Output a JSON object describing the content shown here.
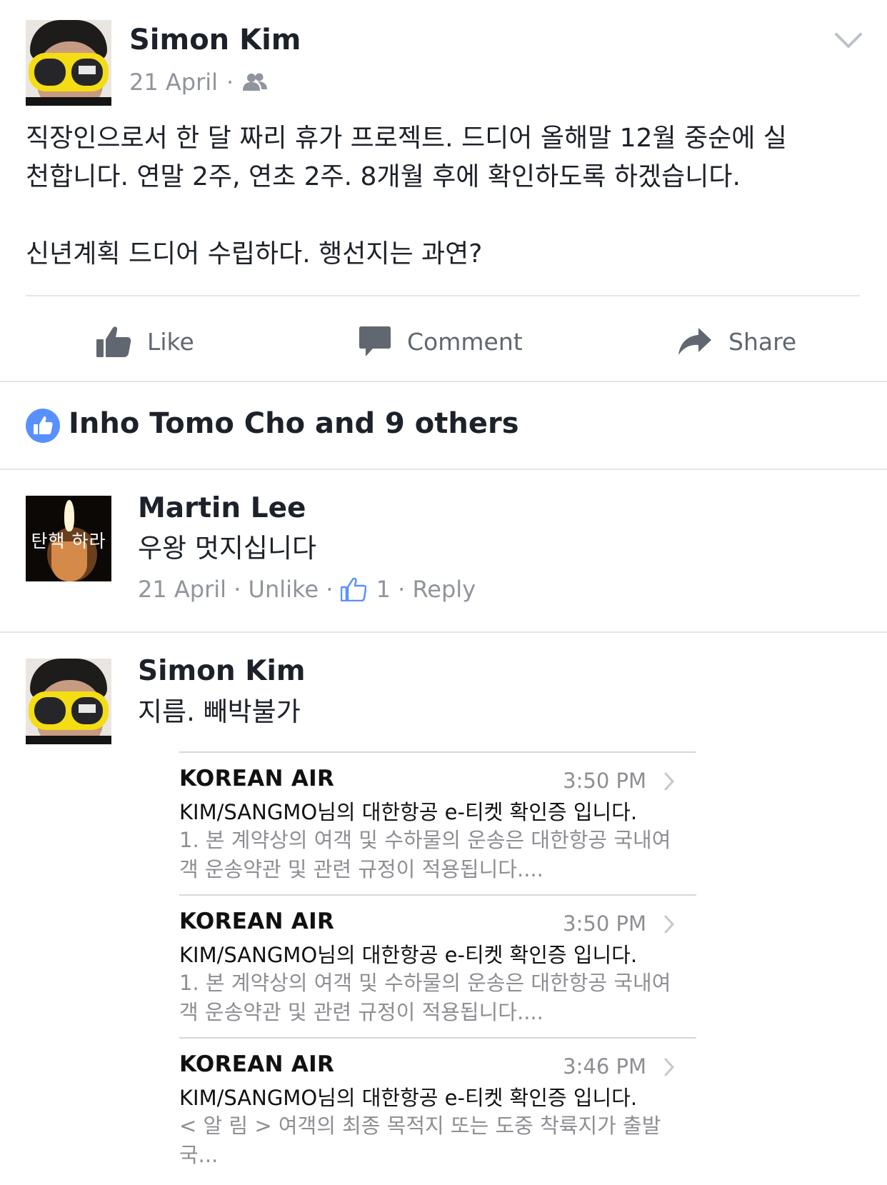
{
  "post": {
    "author": "Simon Kim",
    "date": "21 April",
    "separator": "·",
    "audience_icon": "friends-icon",
    "menu_icon": "chevron-down-icon",
    "text_line1": "직장인으로서 한 달 짜리 휴가 프로젝트. 드디어 올해말 12월 중순에 실",
    "text_line2": "천합니다. 연말 2주, 연초 2주. 8개월 후에 확인하도록 하겠습니다.",
    "text_line3": "신년계획 드디어 수립하다. 행선지는 과연?"
  },
  "actions": {
    "like": "Like",
    "comment": "Comment",
    "share": "Share"
  },
  "likes": {
    "summary": "Inho Tomo Cho and 9 others",
    "icon": "like-badge-icon",
    "badge_color": "#5890ff"
  },
  "comments": [
    {
      "author": "Martin Lee",
      "avatar_caption": "탄핵 하라",
      "text": "우왕 멋지십니다",
      "date": "21 April",
      "sep": " · ",
      "unlike": "Unlike",
      "like_count": "1",
      "reply": "Reply"
    },
    {
      "author": "Simon Kim",
      "text": "지름. 빼박불가"
    }
  ],
  "mails": [
    {
      "sender": "KOREAN AIR",
      "time": "3:50 PM",
      "subject": "KIM/SANGMO님의 대한항공 e-티켓 확인증 입니다.",
      "preview_line1": "1. 본 계약상의 여객 및 수하물의 운송은 대한항공 국내여",
      "preview_line2": "객 운송약관 및 관련 규정이 적용됩니다...."
    },
    {
      "sender": "KOREAN AIR",
      "time": "3:50 PM",
      "subject": "KIM/SANGMO님의 대한항공 e-티켓 확인증 입니다.",
      "preview_line1": "1. 본 계약상의 여객 및 수하물의 운송은 대한항공 국내여",
      "preview_line2": "객 운송약관 및 관련 규정이 적용됩니다...."
    },
    {
      "sender": "KOREAN AIR",
      "time": "3:46 PM",
      "subject": "KIM/SANGMO님의 대한항공 e-티켓 확인증 입니다.",
      "preview_line1": "< 알 림 > 여객의 최종 목적지 또는 도중 착륙지가 출발",
      "preview_line2": "국..."
    }
  ],
  "colors": {
    "text": "#1d2129",
    "meta": "#90949c",
    "action": "#606770",
    "facebook_blue": "#4267b2"
  }
}
